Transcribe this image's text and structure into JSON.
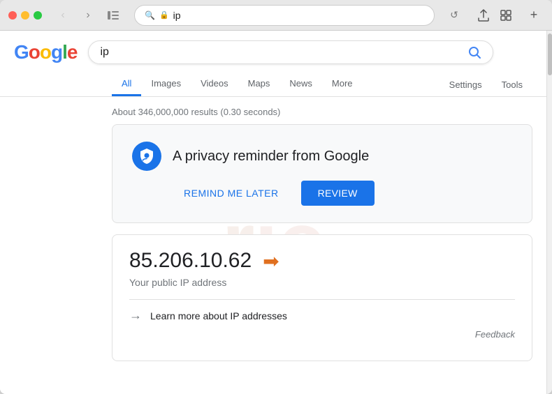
{
  "browser": {
    "address": "ip",
    "address_icon": "🔍",
    "address_lock": "🔒"
  },
  "google": {
    "logo_letters": [
      "G",
      "o",
      "o",
      "g",
      "l",
      "e"
    ],
    "search_query": "ip",
    "search_placeholder": "ip"
  },
  "nav_tabs": {
    "tabs": [
      {
        "label": "All",
        "active": true
      },
      {
        "label": "Images",
        "active": false
      },
      {
        "label": "Videos",
        "active": false
      },
      {
        "label": "Maps",
        "active": false
      },
      {
        "label": "News",
        "active": false
      },
      {
        "label": "More",
        "active": false
      }
    ],
    "right_tabs": [
      "Settings",
      "Tools"
    ]
  },
  "results": {
    "stats": "About 346,000,000 results (0.30 seconds)"
  },
  "privacy_card": {
    "title": "A privacy reminder from Google",
    "remind_later": "REMIND ME LATER",
    "review": "REVIEW"
  },
  "ip_card": {
    "ip_address": "85.206.10.62",
    "label": "Your public IP address",
    "learn_more": "Learn more about IP addresses",
    "feedback": "Feedback"
  }
}
